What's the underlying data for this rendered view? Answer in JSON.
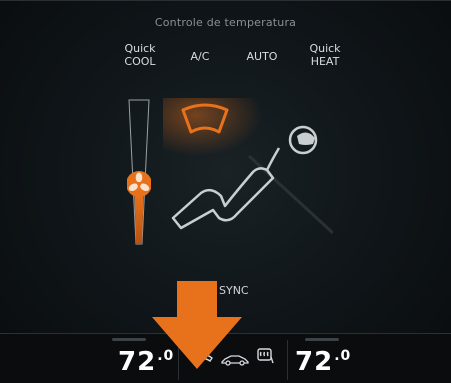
{
  "header": {
    "title": "Controle de temperatura"
  },
  "modes": {
    "quick_cool": {
      "line1": "Quick",
      "line2": "COOL"
    },
    "ac": {
      "label": "A/C"
    },
    "auto": {
      "label": "AUTO"
    },
    "quick_heat": {
      "line1": "Quick",
      "line2": "HEAT"
    }
  },
  "fan": {
    "icon": "fan-icon",
    "level": 0.4
  },
  "airflow": {
    "icon": "seated-person-icon",
    "active_zone": "windshield"
  },
  "sync": {
    "label": "SYNC"
  },
  "bottom_bar": {
    "left_temp": {
      "value": "72",
      "decimal": ".0"
    },
    "right_temp": {
      "value": "72",
      "decimal": ".0"
    },
    "icons": [
      "rear-defrost-icon",
      "recirculation-car-icon",
      "seat-heat-icon"
    ]
  },
  "colors": {
    "accent": "#e8721c",
    "background": "#0f1417",
    "text": "#ffffff",
    "muted": "#8a8f93"
  }
}
